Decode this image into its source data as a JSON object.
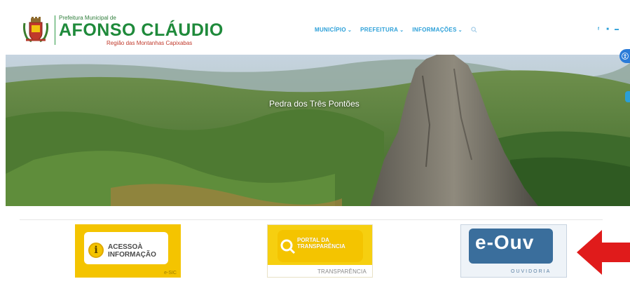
{
  "header": {
    "logo_top": "Prefeitura Municipal de",
    "logo_main": "AFONSO CLÁUDIO",
    "logo_sub": "Região das Montanhas Capixabas"
  },
  "nav": {
    "items": [
      {
        "label": "MUNICÍPIO"
      },
      {
        "label": "PREFEITURA"
      },
      {
        "label": "INFORMAÇÕES"
      }
    ],
    "search_icon": "search-icon"
  },
  "social": [
    {
      "icon": "facebook-icon",
      "glyph": "f"
    },
    {
      "icon": "instagram-icon",
      "glyph": "■"
    },
    {
      "icon": "youtube-icon",
      "glyph": "▬"
    }
  ],
  "banner": {
    "caption": "Pedra dos Três Pontões"
  },
  "cards": {
    "esic": {
      "line1": "ACESSOÀ",
      "line2": "INFORMAÇÃO",
      "footer": "e-SIC"
    },
    "transparencia": {
      "line1": "PORTAL DA",
      "line2": "TRANSPARÊNCIA",
      "footer": "TRANSPARÊNCIA"
    },
    "eouv": {
      "title": "e-Ouv",
      "footer": "OUVIDORIA"
    }
  },
  "colors": {
    "brand_green": "#1f8a3b",
    "nav_blue": "#2a9fd8",
    "accent_red": "#e01b1b",
    "esic_yellow": "#f4c400",
    "eouv_blue": "#3a6e9c"
  }
}
